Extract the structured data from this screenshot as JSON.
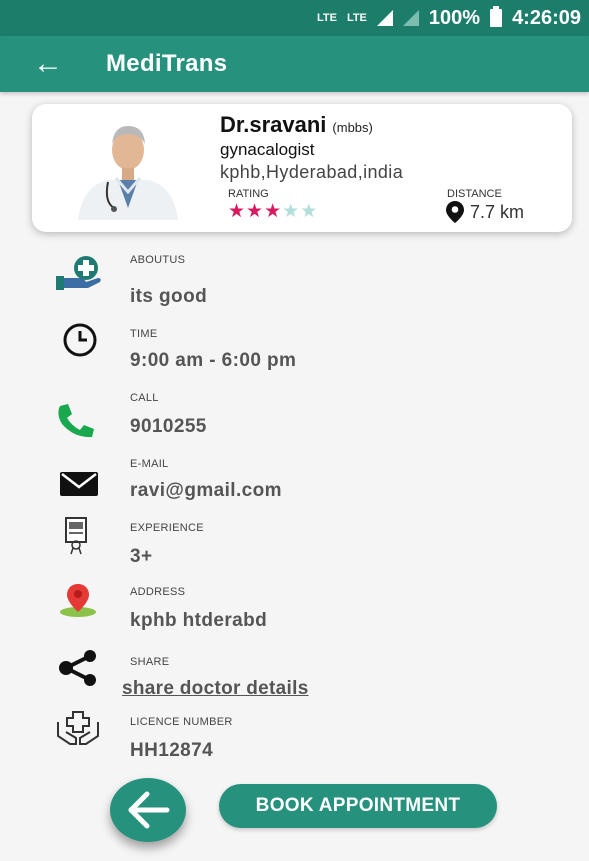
{
  "status_bar": {
    "network1": "LTE",
    "network2": "LTE",
    "battery": "100%",
    "time": "4:26:09"
  },
  "appbar": {
    "title": "MediTrans"
  },
  "doctor": {
    "name": "Dr.sravani",
    "degree": "(mbbs)",
    "specialty": "gynacalogist",
    "location": "kphb,Hyderabad,india",
    "rating_label": "RATING",
    "rating": 3,
    "rating_max": 5,
    "distance_label": "DISTANCE",
    "distance": "7.7 km"
  },
  "details": {
    "aboutus": {
      "label": "ABOUTUS",
      "value": "its good",
      "icon": "hand-plus-icon"
    },
    "time": {
      "label": "TIME",
      "value": "9:00 am - 6:00 pm",
      "icon": "clock-icon"
    },
    "call": {
      "label": "CALL",
      "value": "9010255",
      "icon": "phone-icon"
    },
    "email": {
      "label": "E-MAIL",
      "value": "ravi@gmail.com",
      "icon": "mail-icon"
    },
    "experience": {
      "label": "EXPERIENCE",
      "value": "3+",
      "icon": "certificate-icon"
    },
    "address": {
      "label": "ADDRESS",
      "value": "kphb htderabd",
      "icon": "map-pin-icon"
    },
    "share": {
      "label": "SHARE",
      "value": "share doctor details",
      "icon": "share-icon"
    },
    "licence": {
      "label": "LICENCE NUMBER",
      "value": "HH12874",
      "icon": "hands-cross-icon"
    }
  },
  "actions": {
    "book_label": "BOOK APPOINTMENT"
  },
  "colors": {
    "primary": "#26917d",
    "status_bar": "#1d7d6b",
    "star_on": "#d81b60",
    "star_off": "#b2dfdb",
    "phone_green": "#1aa84f",
    "pin_red": "#e53935"
  }
}
